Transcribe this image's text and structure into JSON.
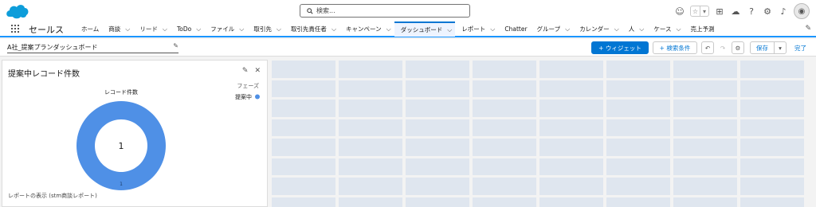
{
  "header": {
    "search_placeholder": "検索..."
  },
  "nav": {
    "app_name": "セールス",
    "items": [
      {
        "label": "ホーム",
        "chevron": false
      },
      {
        "label": "商談",
        "chevron": true
      },
      {
        "label": "リード",
        "chevron": true
      },
      {
        "label": "ToDo",
        "chevron": true
      },
      {
        "label": "ファイル",
        "chevron": true
      },
      {
        "label": "取引先",
        "chevron": true
      },
      {
        "label": "取引先責任者",
        "chevron": true
      },
      {
        "label": "キャンペーン",
        "chevron": true
      },
      {
        "label": "ダッシュボード",
        "chevron": true,
        "active": true
      },
      {
        "label": "レポート",
        "chevron": true
      },
      {
        "label": "Chatter",
        "chevron": false
      },
      {
        "label": "グループ",
        "chevron": true
      },
      {
        "label": "カレンダー",
        "chevron": true
      },
      {
        "label": "人",
        "chevron": true
      },
      {
        "label": "ケース",
        "chevron": true
      },
      {
        "label": "売上予測",
        "chevron": false
      }
    ]
  },
  "toolbar": {
    "dashboard_title": "A社_提案プランダッシュボード",
    "widget_button": "+ ウィジェット",
    "filter_button": "+ 検索条件",
    "save_button": "保存",
    "done_link": "完了"
  },
  "widget": {
    "title": "提案中レコード件数",
    "footer": "レポートの表示 (stm商談レポート)"
  },
  "chart_data": {
    "type": "pie",
    "title": "レコード件数",
    "center_total": "1",
    "legend_title": "フェーズ",
    "legend_position": "right",
    "slices": [
      {
        "label": "提案中",
        "value": 1,
        "color": "#4f90e6"
      }
    ],
    "data_labels": [
      "1"
    ]
  },
  "colors": {
    "brand": "#0176d3",
    "donut": "#4f90e6",
    "placeholder": "#dfe6ef"
  }
}
